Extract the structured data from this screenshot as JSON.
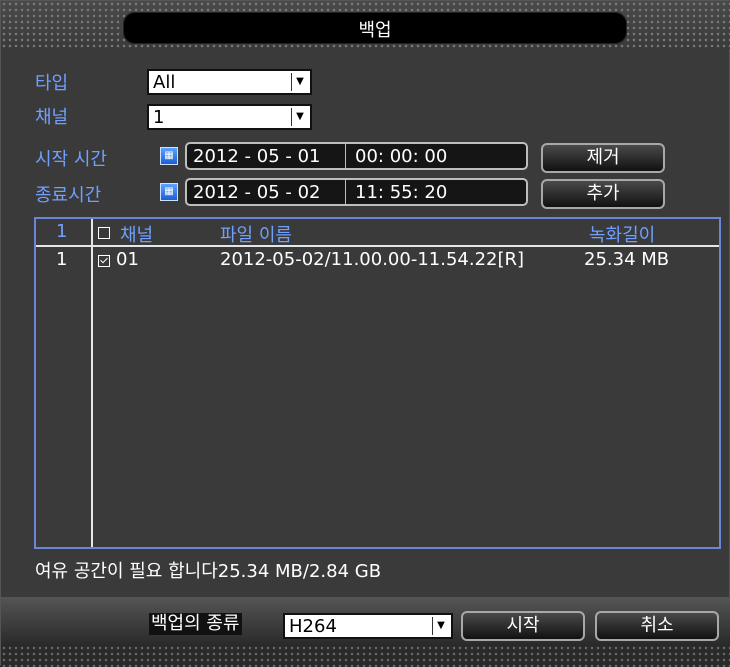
{
  "window": {
    "title": "백업"
  },
  "form": {
    "type_label": "타입",
    "type_value": "All",
    "channel_label": "채널",
    "channel_value": "1",
    "start_label": "시작 시간",
    "start_date": "2012 - 05 - 01",
    "start_time": "00: 00: 00",
    "end_label": "종료시간",
    "end_date": "2012 - 05 - 02",
    "end_time": "11: 55: 20",
    "remove_button": "제거",
    "add_button": "추가",
    "calendar_icon": "calendar-icon"
  },
  "list": {
    "headers": {
      "index": "1",
      "channel": "채널",
      "filename": "파일 이름",
      "length": "녹화길이"
    },
    "rows": [
      {
        "index": "1",
        "checked": true,
        "channel": "01",
        "filename": "2012-05-02/11.00.00-11.54.22[R]",
        "size": "25.34 MB"
      }
    ]
  },
  "status": {
    "text": "여유 공간이 필요 합니다25.34 MB/2.84 GB"
  },
  "bottom": {
    "backup_type_label": "백업의 종류",
    "backup_type_value": "H264",
    "start_button": "시작",
    "cancel_button": "취소"
  }
}
